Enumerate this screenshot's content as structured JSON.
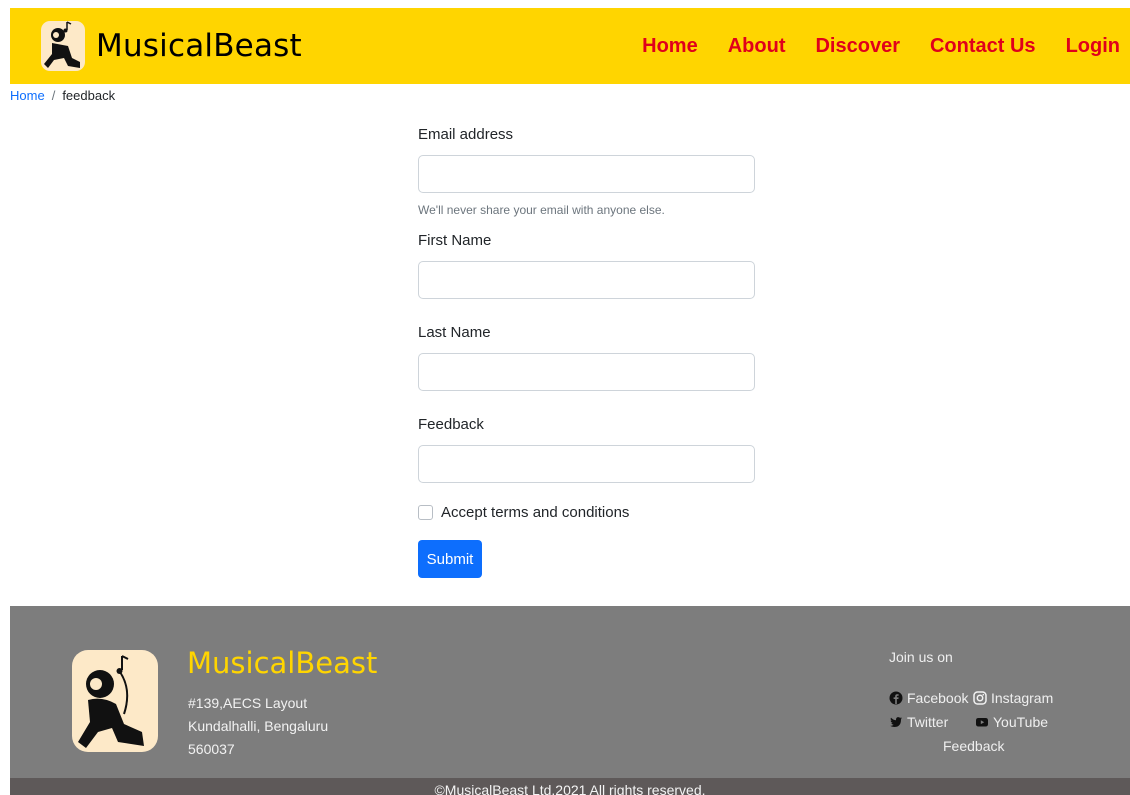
{
  "brand": {
    "name": "MusicalBeast"
  },
  "nav": {
    "items": [
      {
        "label": "Home"
      },
      {
        "label": "About"
      },
      {
        "label": "Discover"
      },
      {
        "label": "Contact Us"
      },
      {
        "label": "Login"
      }
    ]
  },
  "breadcrumb": {
    "home": "Home",
    "separator": "/",
    "current": "feedback"
  },
  "form": {
    "email_label": "Email address",
    "email_help": "We'll never share your email with anyone else.",
    "first_name_label": "First Name",
    "last_name_label": "Last Name",
    "feedback_label": "Feedback",
    "terms_label": "Accept terms and conditions",
    "submit_label": "Submit"
  },
  "footer": {
    "brand": "MusicalBeast",
    "address_line1": "#139,AECS Layout",
    "address_line2": "Kundalhalli, Bengaluru",
    "address_line3": "560037",
    "join_label": "Join us on",
    "social": {
      "facebook": "Facebook",
      "instagram": "Instagram",
      "twitter": "Twitter",
      "youtube": "YouTube",
      "feedback": "Feedback"
    },
    "copyright": "©MusicalBeast Ltd.2021 All rights reserved."
  },
  "colors": {
    "navbar": "#ffd500",
    "nav_link": "#e0001b",
    "primary": "#0d6efd",
    "footer": "#7d7d7d",
    "copyright_bar": "#5e5959",
    "footer_brand": "#ffd500"
  },
  "icons": {
    "brand_logo": "listener-with-headphones-icon",
    "facebook": "facebook-icon",
    "instagram": "instagram-icon",
    "twitter": "twitter-icon",
    "youtube": "youtube-icon"
  }
}
